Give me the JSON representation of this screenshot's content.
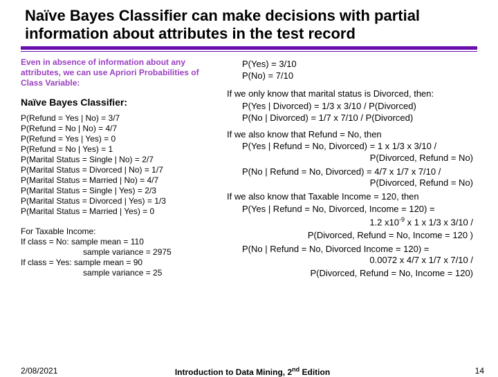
{
  "title": "Naïve Bayes Classifier can make decisions with partial information about attributes in the test record",
  "intro": "Even in absence of information about any attributes, we can use Apriori Probabilities of Class Variable:",
  "subhead": "Naïve  Bayes Classifier:",
  "left_probs": [
    "P(Refund = Yes | No) = 3/7",
    "P(Refund = No | No) = 4/7",
    "P(Refund = Yes | Yes) = 0",
    "P(Refund = No | Yes) = 1",
    "P(Marital Status = Single | No) = 2/7",
    "P(Marital Status = Divorced | No) = 1/7",
    "P(Marital Status = Married | No) = 4/7",
    "P(Marital Status = Single | Yes) = 2/3",
    "P(Marital Status = Divorced | Yes) = 1/3",
    "P(Marital Status = Married | Yes) = 0"
  ],
  "income": {
    "head": "For Taxable Income:",
    "no1": "If class = No: sample mean = 110",
    "no2": "sample variance = 2975",
    "yes1": "If class = Yes: sample mean = 90",
    "yes2": "sample variance = 25"
  },
  "right": {
    "pyes": "P(Yes) = 3/10",
    "pno": "P(No) = 7/10",
    "div_head": "If we only know that marital status is Divorced, then:",
    "div_yes": "P(Yes | Divorced) = 1/3 x 3/10 / P(Divorced)",
    "div_no": "P(No | Divorced) = 1/7 x 7/10 / P(Divorced)",
    "ref_head": "If we also know that Refund = No, then",
    "ref_yes_a": "P(Yes | Refund = No, Divorced) = 1 x 1/3 x 3/10 /",
    "ref_yes_b": "P(Divorced, Refund = No)",
    "ref_no_a": "P(No | Refund = No, Divorced) = 4/7 x 1/7 x  7/10 /",
    "ref_no_b": "P(Divorced, Refund = No)",
    "tax_head": "If we also know that Taxable Income = 120, then",
    "tax_yes_a": "P(Yes | Refund = No, Divorced, Income = 120) =",
    "tax_yes_b1": "1.2 x10",
    "tax_yes_b2": " x  1 x 1/3 x 3/10 /",
    "tax_yes_c": "P(Divorced, Refund = No,  Income = 120 )",
    "tax_no_a": "P(No | Refund = No, Divorced Income = 120) =",
    "tax_no_b": "0.0072  x 4/7 x 1/7 x 7/10 /",
    "tax_no_c": "P(Divorced, Refund = No, Income = 120)"
  },
  "footer": {
    "date": "2/08/2021",
    "center_a": "Introduction to Data Mining, 2",
    "center_b": " Edition",
    "pagenum": "14"
  }
}
